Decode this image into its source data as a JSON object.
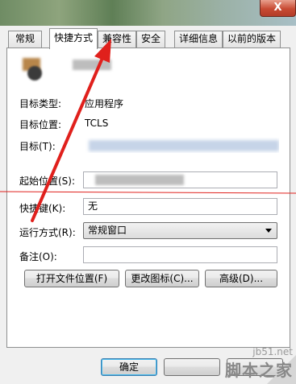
{
  "window": {
    "close_glyph": "X"
  },
  "tabs": [
    {
      "label": "常规"
    },
    {
      "label": "快捷方式"
    },
    {
      "label": "兼容性"
    },
    {
      "label": "安全"
    },
    {
      "label": "详细信息"
    },
    {
      "label": "以前的版本"
    }
  ],
  "shortcut": {
    "target_type_label": "目标类型:",
    "target_type_value": "应用程序",
    "target_location_label": "目标位置:",
    "target_location_value": "TCLS",
    "target_label": "目标(T):",
    "start_in_label": "起始位置(S):",
    "shortcut_key_label": "快捷键(K):",
    "shortcut_key_value": "无",
    "run_label": "运行方式(R):",
    "run_value": "常规窗口",
    "comment_label": "备注(O):",
    "comment_value": ""
  },
  "buttons": {
    "open_location": "打开文件位置(F)",
    "change_icon": "更改图标(C)...",
    "advanced": "高级(D)...",
    "ok": "确定"
  },
  "watermark": {
    "url": "jb51.net",
    "name": "脚本之家"
  },
  "colors": {
    "annotation_red": "#e0201c",
    "default_button_border": "#3c7fb1"
  }
}
